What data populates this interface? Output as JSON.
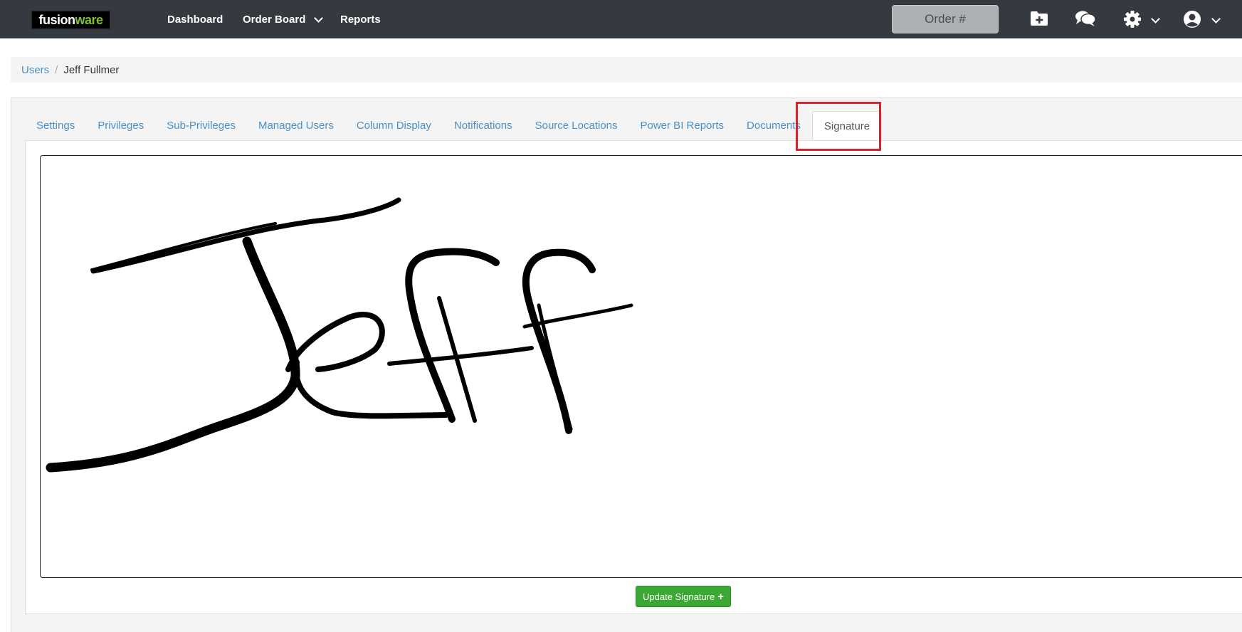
{
  "brand": {
    "part1": "fusion",
    "part2": "ware"
  },
  "nav": {
    "dashboard": "Dashboard",
    "order_board": "Order Board",
    "reports": "Reports"
  },
  "search": {
    "placeholder": "Order #"
  },
  "icons": {
    "new_folder": "folder-plus-icon",
    "chat": "comments-icon",
    "settings": "gear-icon",
    "user": "user-circle-icon"
  },
  "breadcrumb": {
    "root": "Users",
    "current": "Jeff Fullmer"
  },
  "tabs": [
    "Settings",
    "Privileges",
    "Sub-Privileges",
    "Managed Users",
    "Column Display",
    "Notifications",
    "Source Locations",
    "Power BI Reports",
    "Documents",
    "Signature"
  ],
  "active_tab": "Signature",
  "signature": {
    "text": "Jeff"
  },
  "actions": {
    "update_signature": "Update Signature"
  },
  "colors": {
    "topbar": "#343a40",
    "link": "#4a90c8",
    "button": "#3aa832",
    "highlight": "#d9232a"
  }
}
